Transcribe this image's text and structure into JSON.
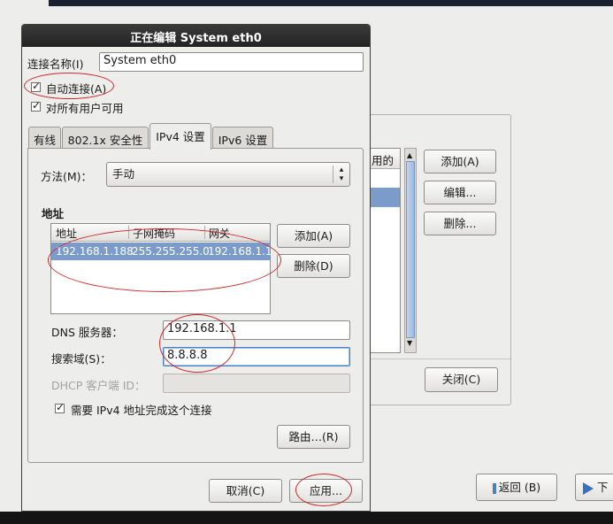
{
  "dialog": {
    "title": "正在编辑 System eth0",
    "conn_name_label": "连接名称(I)",
    "conn_name_value": "System eth0",
    "auto_connect_label": "自动连接(A)",
    "all_users_label": "对所有用户可用"
  },
  "tabs": [
    {
      "label": "有线"
    },
    {
      "label": "802.1x 安全性"
    },
    {
      "label": "IPv4 设置"
    },
    {
      "label": "IPv6 设置"
    }
  ],
  "ipv4": {
    "method_label": "方法(M)：",
    "method_value": "手动",
    "address_section": "地址",
    "columns": [
      "地址",
      "子网掩码",
      "网关"
    ],
    "row": {
      "address": "192.168.1.188",
      "netmask": "255.255.255.0",
      "gateway": "192.168.1.1"
    },
    "add_button": "添加(A)",
    "delete_button": "删除(D)",
    "dns_label": "DNS 服务器：",
    "dns_value": "192.168.1.1",
    "search_label": "搜索域(S)：",
    "search_value": "8.8.8.8",
    "dhcp_label": "DHCP 客户端 ID：",
    "require_label": "需要 IPv4 地址完成这个连接",
    "routes_button": "路由…(R)"
  },
  "footer": {
    "cancel": "取消(C)",
    "apply": "应用..."
  },
  "background_window": {
    "header_partial": "用的",
    "add": "添加(A)",
    "edit": "编辑...",
    "delete": "删除...",
    "close": "关闭(C)"
  },
  "installer": {
    "back": "返回 (B)",
    "next_partial": "下"
  },
  "colors": {
    "titlebar": "#2a2a2a",
    "selection": "#7b9ccb",
    "annotation": "#d0282a",
    "focus": "#4a7fc4"
  }
}
